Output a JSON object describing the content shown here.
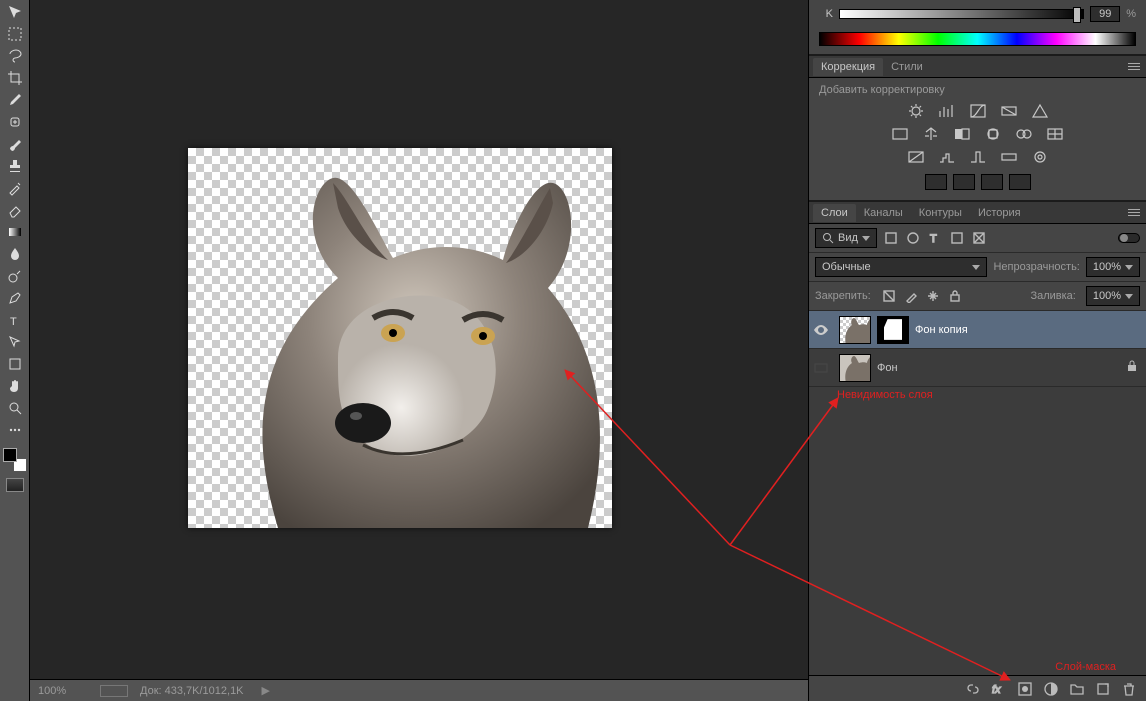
{
  "status": {
    "zoom": "100%",
    "docinfo": "Док: 433,7K/1012,1K"
  },
  "color_panel": {
    "channel": "K",
    "value": "99",
    "unit": "%"
  },
  "adjustments": {
    "tab1": "Коррекция",
    "tab2": "Стили",
    "title": "Добавить корректировку"
  },
  "layers": {
    "tabs": {
      "t1": "Слои",
      "t2": "Каналы",
      "t3": "Контуры",
      "t4": "История"
    },
    "filter_label": "Вид",
    "blend_mode": "Обычные",
    "opacity_label": "Непрозрачность:",
    "opacity_value": "100%",
    "lock_label": "Закрепить:",
    "fill_label": "Заливка:",
    "fill_value": "100%",
    "items": [
      {
        "name": "Фон копия",
        "visible": true,
        "selected": true,
        "has_mask": true,
        "locked": false
      },
      {
        "name": "Фон",
        "visible": false,
        "selected": false,
        "has_mask": false,
        "locked": true
      }
    ]
  },
  "annotations": {
    "a1": "Невидимость слоя",
    "a2": "Слой-маска"
  },
  "icons": {
    "tools": [
      "move",
      "marquee",
      "lasso",
      "crop",
      "eyedropper",
      "heal",
      "brush",
      "stamp",
      "history",
      "eraser",
      "gradient",
      "blur",
      "dodge",
      "pen",
      "type",
      "path",
      "shape",
      "hand",
      "zoom"
    ]
  }
}
